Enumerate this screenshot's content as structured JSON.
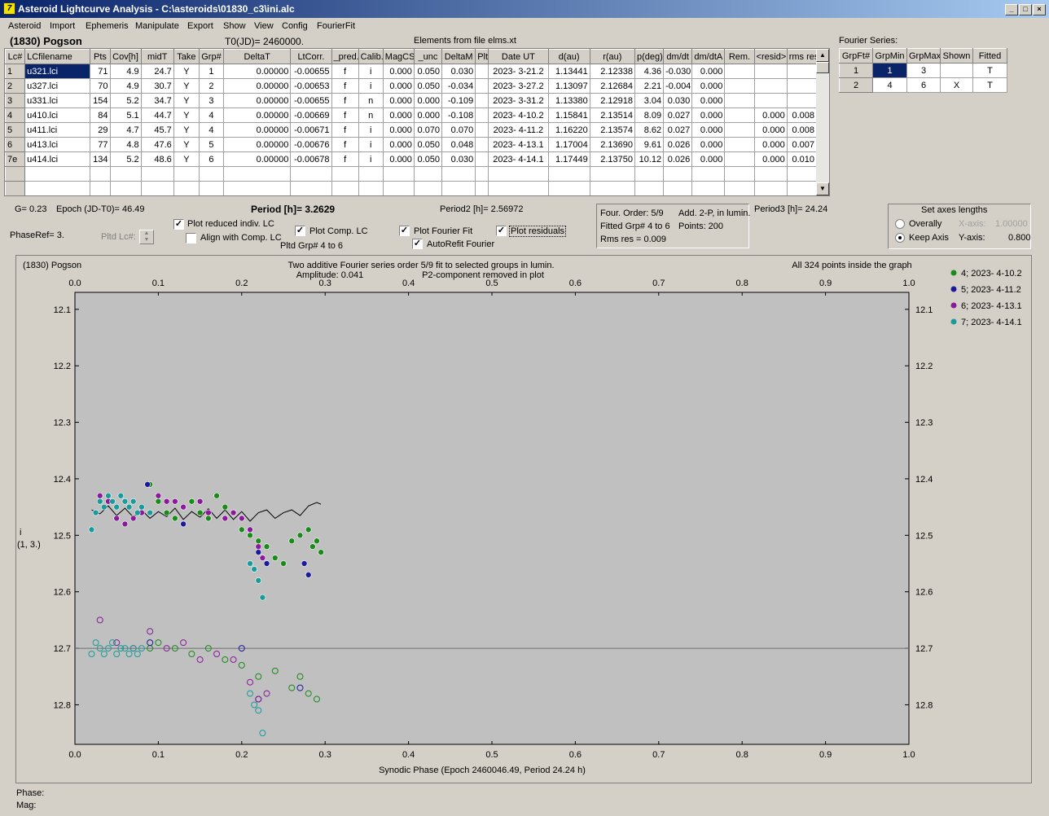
{
  "window": {
    "title": "Asteroid Lightcurve Analysis - C:\\asteroids\\01830_c3\\ini.alc"
  },
  "menu": [
    "Asteroid",
    "Import",
    "Ephemeris",
    "Manipulate",
    "Export",
    "Show",
    "View",
    "Config",
    "FourierFit"
  ],
  "header": {
    "asteroid": "(1830) Pogson",
    "t0": "T0(JD)= 2460000.",
    "elements": "Elements from file elms.xt",
    "fourier_title": "Fourier Series:"
  },
  "lc_table": {
    "columns": [
      "Lc#",
      "LCfilename",
      "Pts",
      "Cov[h]",
      "midT",
      "Take",
      "Grp#",
      "DeltaT",
      "LtCorr.",
      "_pred.",
      "Calib.",
      "MagCS",
      "_unc",
      "DeltaM",
      "Plt",
      "Date UT",
      "d(au)",
      "r(au)",
      "p(deg)",
      "dm/dt",
      "dm/dtA",
      "Rem.",
      "<resid>",
      "rms res"
    ],
    "rows": [
      [
        "1",
        "u321.lci",
        "71",
        "4.9",
        "24.7",
        "Y",
        "1",
        "0.00000",
        "-0.00655",
        "f",
        "i",
        "0.000",
        "0.050",
        "0.030",
        "",
        "2023- 3-21.2",
        "1.13441",
        "2.12338",
        "4.36",
        "-0.030",
        "0.000",
        "",
        "",
        ""
      ],
      [
        "2",
        "u327.lci",
        "70",
        "4.9",
        "30.7",
        "Y",
        "2",
        "0.00000",
        "-0.00653",
        "f",
        "i",
        "0.000",
        "0.050",
        "-0.034",
        "",
        "2023- 3-27.2",
        "1.13097",
        "2.12684",
        "2.21",
        "-0.004",
        "0.000",
        "",
        "",
        ""
      ],
      [
        "3",
        "u331.lci",
        "154",
        "5.2",
        "34.7",
        "Y",
        "3",
        "0.00000",
        "-0.00655",
        "f",
        "n",
        "0.000",
        "0.000",
        "-0.109",
        "",
        "2023- 3-31.2",
        "1.13380",
        "2.12918",
        "3.04",
        "0.030",
        "0.000",
        "",
        "",
        ""
      ],
      [
        "4",
        "u410.lci",
        "84",
        "5.1",
        "44.7",
        "Y",
        "4",
        "0.00000",
        "-0.00669",
        "f",
        "n",
        "0.000",
        "0.000",
        "-0.108",
        "",
        "2023- 4-10.2",
        "1.15841",
        "2.13514",
        "8.09",
        "0.027",
        "0.000",
        "",
        "0.000",
        "0.008"
      ],
      [
        "5",
        "u411.lci",
        "29",
        "4.7",
        "45.7",
        "Y",
        "4",
        "0.00000",
        "-0.00671",
        "f",
        "i",
        "0.000",
        "0.070",
        "0.070",
        "",
        "2023- 4-11.2",
        "1.16220",
        "2.13574",
        "8.62",
        "0.027",
        "0.000",
        "",
        "0.000",
        "0.008"
      ],
      [
        "6",
        "u413.lci",
        "77",
        "4.8",
        "47.6",
        "Y",
        "5",
        "0.00000",
        "-0.00676",
        "f",
        "i",
        "0.000",
        "0.050",
        "0.048",
        "",
        "2023- 4-13.1",
        "1.17004",
        "2.13690",
        "9.61",
        "0.026",
        "0.000",
        "",
        "0.000",
        "0.007"
      ],
      [
        "7e",
        "u414.lci",
        "134",
        "5.2",
        "48.6",
        "Y",
        "6",
        "0.00000",
        "-0.00678",
        "f",
        "i",
        "0.000",
        "0.050",
        "0.030",
        "",
        "2023- 4-14.1",
        "1.17449",
        "2.13750",
        "10.12",
        "0.026",
        "0.000",
        "",
        "0.000",
        "0.010"
      ]
    ]
  },
  "fourier_table": {
    "columns": [
      "GrpFt#",
      "GrpMin",
      "GrpMax",
      "Shown",
      "Fitted"
    ],
    "rows": [
      [
        "1",
        "1",
        "3",
        "",
        "T"
      ],
      [
        "2",
        "4",
        "6",
        "X",
        "T"
      ]
    ]
  },
  "params": {
    "g": "G= 0.23",
    "epoch": "Epoch (JD-T0)= 46.49",
    "period": "Period [h]= 3.2629",
    "period2": "Period2 [h]= 2.56972",
    "period3": "Period3 [h]= 24.24",
    "phaseref": "PhaseRef= 3.",
    "pltd_lc": "Pltd Lc#:",
    "pltd_grp": "Pltd Grp#  4   to   6"
  },
  "options": {
    "plot_reduced": "Plot reduced indiv. LC",
    "align_comp": "Align with Comp. LC",
    "plot_comp": "Plot Comp. LC",
    "plot_fourier": "Plot Fourier Fit",
    "plot_residuals": "Plot residuals",
    "autorefit": "AutoRefit Fourier",
    "plot_reduced_checked": true,
    "align_comp_checked": false,
    "plot_comp_checked": true,
    "plot_fourier_checked": true,
    "plot_residuals_checked": true,
    "autorefit_checked": true
  },
  "fit_info": {
    "order": "Four. Order:  5/9",
    "add": "Add. 2-P, in lumin.",
    "fitted": "Fitted Grp# 4 to 6",
    "points": "Points: 200",
    "rms": "Rms res     = 0.009"
  },
  "axes_panel": {
    "title": "Set axes lengths",
    "overally": "Overally",
    "keep": "Keep Axis",
    "xaxis_label": "X-axis:",
    "xaxis_value": "1.00000",
    "yaxis_label": "Y-axis:",
    "yaxis_value": "0.800",
    "selected": "Keep Axis"
  },
  "status": {
    "phase": "Phase:",
    "mag": "Mag:"
  },
  "colors": {
    "g4": "#1a8a1a",
    "g5": "#1a1a9a",
    "g6": "#8a1a9a",
    "g7": "#1a9a9a",
    "plot_bg": "#c0c0c0"
  },
  "chart_data": {
    "type": "scatter",
    "title": "Two additive Fourier series order 5/9 fit to selected groups in lumin.",
    "subtitle": "Amplitude: 0.041",
    "note_right": "P2-component removed in plot",
    "top_left": "(1830) Pogson",
    "top_right": "All 324 points inside the graph",
    "xlabel": "Synodic Phase (Epoch 2460046.49, Period 24.24 h)",
    "ylabel": "i",
    "ylabel2": "(1, 3.)",
    "xlim": [
      0,
      1
    ],
    "ylim": [
      12.07,
      12.87
    ],
    "x_ticks": [
      "0.0",
      "0.1",
      "0.2",
      "0.3",
      "0.4",
      "0.5",
      "0.6",
      "0.7",
      "0.8",
      "0.9",
      "1.0"
    ],
    "y_ticks": [
      "12.1",
      "12.2",
      "12.3",
      "12.4",
      "12.5",
      "12.6",
      "12.7",
      "12.8"
    ],
    "y_tick_values": [
      12.1,
      12.2,
      12.3,
      12.4,
      12.5,
      12.6,
      12.7,
      12.8
    ],
    "hline": 12.7,
    "legend": [
      {
        "name": "4; 2023- 4-10.2",
        "color": "#1a8a1a"
      },
      {
        "name": "5; 2023- 4-11.2",
        "color": "#1a1a9a"
      },
      {
        "name": "6; 2023- 4-13.1",
        "color": "#8a1a9a"
      },
      {
        "name": "7; 2023- 4-14.1",
        "color": "#1a9a9a"
      }
    ],
    "fourier_curve": [
      [
        0.02,
        12.455
      ],
      [
        0.03,
        12.462
      ],
      [
        0.04,
        12.448
      ],
      [
        0.05,
        12.465
      ],
      [
        0.06,
        12.452
      ],
      [
        0.07,
        12.468
      ],
      [
        0.08,
        12.455
      ],
      [
        0.09,
        12.47
      ],
      [
        0.1,
        12.458
      ],
      [
        0.11,
        12.467
      ],
      [
        0.12,
        12.452
      ],
      [
        0.13,
        12.472
      ],
      [
        0.14,
        12.458
      ],
      [
        0.15,
        12.468
      ],
      [
        0.16,
        12.453
      ],
      [
        0.17,
        12.47
      ],
      [
        0.18,
        12.455
      ],
      [
        0.19,
        12.472
      ],
      [
        0.2,
        12.458
      ],
      [
        0.21,
        12.475
      ],
      [
        0.22,
        12.46
      ],
      [
        0.23,
        12.455
      ],
      [
        0.24,
        12.47
      ],
      [
        0.25,
        12.46
      ],
      [
        0.26,
        12.455
      ],
      [
        0.27,
        12.465
      ],
      [
        0.28,
        12.448
      ],
      [
        0.29,
        12.442
      ],
      [
        0.295,
        12.445
      ]
    ],
    "series": [
      {
        "name": "4; 2023- 4-10.2",
        "points": [
          [
            0.09,
            12.41
          ],
          [
            0.1,
            12.44
          ],
          [
            0.11,
            12.46
          ],
          [
            0.12,
            12.47
          ],
          [
            0.13,
            12.45
          ],
          [
            0.14,
            12.44
          ],
          [
            0.15,
            12.46
          ],
          [
            0.16,
            12.47
          ],
          [
            0.17,
            12.43
          ],
          [
            0.18,
            12.45
          ],
          [
            0.19,
            12.46
          ],
          [
            0.2,
            12.49
          ],
          [
            0.21,
            12.5
          ],
          [
            0.22,
            12.51
          ],
          [
            0.23,
            12.52
          ],
          [
            0.24,
            12.54
          ],
          [
            0.25,
            12.55
          ],
          [
            0.26,
            12.51
          ],
          [
            0.27,
            12.5
          ],
          [
            0.28,
            12.49
          ],
          [
            0.285,
            12.52
          ],
          [
            0.29,
            12.51
          ],
          [
            0.295,
            12.53
          ]
        ],
        "residuals": [
          [
            0.09,
            12.7
          ],
          [
            0.1,
            12.69
          ],
          [
            0.12,
            12.7
          ],
          [
            0.14,
            12.71
          ],
          [
            0.16,
            12.7
          ],
          [
            0.18,
            12.72
          ],
          [
            0.2,
            12.73
          ],
          [
            0.22,
            12.75
          ],
          [
            0.24,
            12.74
          ],
          [
            0.26,
            12.77
          ],
          [
            0.27,
            12.75
          ],
          [
            0.28,
            12.78
          ],
          [
            0.29,
            12.79
          ]
        ]
      },
      {
        "name": "5; 2023- 4-11.2",
        "points": [
          [
            0.087,
            12.41
          ],
          [
            0.13,
            12.48
          ],
          [
            0.2,
            12.47
          ],
          [
            0.22,
            12.53
          ],
          [
            0.23,
            12.55
          ],
          [
            0.275,
            12.55
          ],
          [
            0.28,
            12.57
          ]
        ],
        "residuals": [
          [
            0.09,
            12.69
          ],
          [
            0.2,
            12.7
          ],
          [
            0.22,
            12.79
          ],
          [
            0.27,
            12.77
          ]
        ]
      },
      {
        "name": "6; 2023- 4-13.1",
        "points": [
          [
            0.03,
            12.43
          ],
          [
            0.04,
            12.44
          ],
          [
            0.05,
            12.47
          ],
          [
            0.06,
            12.48
          ],
          [
            0.07,
            12.47
          ],
          [
            0.08,
            12.46
          ],
          [
            0.1,
            12.43
          ],
          [
            0.11,
            12.44
          ],
          [
            0.12,
            12.44
          ],
          [
            0.13,
            12.45
          ],
          [
            0.15,
            12.44
          ],
          [
            0.16,
            12.46
          ],
          [
            0.18,
            12.47
          ],
          [
            0.19,
            12.46
          ],
          [
            0.2,
            12.47
          ],
          [
            0.21,
            12.49
          ],
          [
            0.22,
            12.52
          ],
          [
            0.225,
            12.54
          ]
        ],
        "residuals": [
          [
            0.03,
            12.65
          ],
          [
            0.05,
            12.69
          ],
          [
            0.07,
            12.7
          ],
          [
            0.09,
            12.67
          ],
          [
            0.11,
            12.7
          ],
          [
            0.13,
            12.69
          ],
          [
            0.15,
            12.72
          ],
          [
            0.17,
            12.71
          ],
          [
            0.19,
            12.72
          ],
          [
            0.21,
            12.76
          ],
          [
            0.22,
            12.79
          ],
          [
            0.23,
            12.78
          ]
        ]
      },
      {
        "name": "7; 2023- 4-14.1",
        "points": [
          [
            0.02,
            12.49
          ],
          [
            0.025,
            12.46
          ],
          [
            0.03,
            12.44
          ],
          [
            0.035,
            12.45
          ],
          [
            0.04,
            12.43
          ],
          [
            0.045,
            12.44
          ],
          [
            0.05,
            12.45
          ],
          [
            0.055,
            12.43
          ],
          [
            0.06,
            12.44
          ],
          [
            0.065,
            12.45
          ],
          [
            0.07,
            12.44
          ],
          [
            0.075,
            12.46
          ],
          [
            0.08,
            12.45
          ],
          [
            0.09,
            12.46
          ],
          [
            0.21,
            12.55
          ],
          [
            0.215,
            12.56
          ],
          [
            0.22,
            12.58
          ],
          [
            0.225,
            12.61
          ]
        ],
        "residuals": [
          [
            0.02,
            12.71
          ],
          [
            0.025,
            12.69
          ],
          [
            0.03,
            12.7
          ],
          [
            0.035,
            12.71
          ],
          [
            0.04,
            12.7
          ],
          [
            0.045,
            12.69
          ],
          [
            0.05,
            12.71
          ],
          [
            0.055,
            12.7
          ],
          [
            0.06,
            12.7
          ],
          [
            0.065,
            12.71
          ],
          [
            0.07,
            12.7
          ],
          [
            0.075,
            12.71
          ],
          [
            0.08,
            12.7
          ],
          [
            0.21,
            12.78
          ],
          [
            0.215,
            12.8
          ],
          [
            0.22,
            12.81
          ],
          [
            0.225,
            12.85
          ]
        ]
      }
    ]
  }
}
